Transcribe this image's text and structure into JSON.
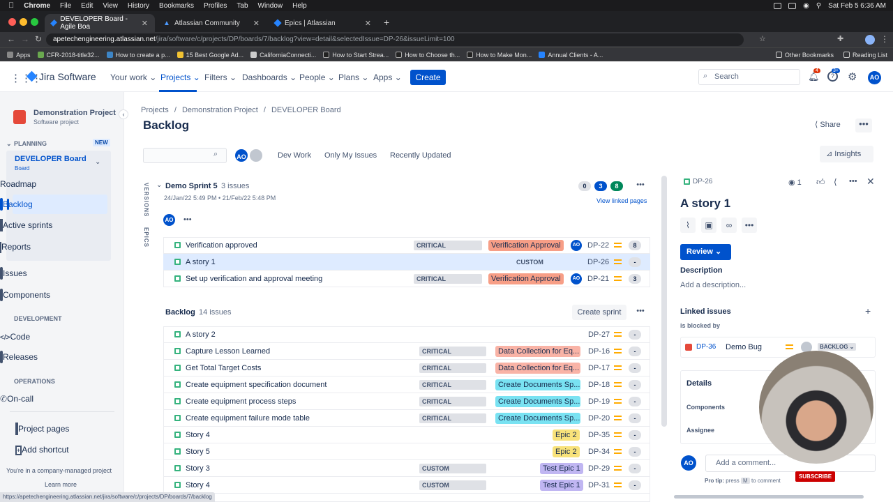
{
  "mac": {
    "app": "Chrome",
    "menus": [
      "File",
      "Edit",
      "View",
      "History",
      "Bookmarks",
      "Profiles",
      "Tab",
      "Window",
      "Help"
    ],
    "clock": "Sat Feb 5  6:36 AM"
  },
  "tabs": [
    {
      "label": "DEVELOPER Board - Agile Boa"
    },
    {
      "label": "Atlassian Community"
    },
    {
      "label": "Epics | Atlassian"
    }
  ],
  "address": {
    "host": "apetechengineering.atlassian.net",
    "path": "/jira/software/c/projects/DP/boards/7/backlog?view=detail&selectedIssue=DP-26&issueLimit=100"
  },
  "bookmarks": [
    "Apps",
    "CFR-2018-title32...",
    "How to create a p...",
    "15 Best Google Ad...",
    "CaliforniaConnecti...",
    "How to Start Strea...",
    "How to Choose th...",
    "How to Make Mon...",
    "Annual Clients - A..."
  ],
  "bookmarks_right": [
    "Other Bookmarks",
    "Reading List"
  ],
  "jira": {
    "logo": "Jira Software",
    "nav": [
      "Your work",
      "Projects",
      "Filters",
      "Dashboards",
      "People",
      "Plans",
      "Apps"
    ],
    "create": "Create",
    "search_placeholder": "Search",
    "notif_count": "4",
    "help_count": "3+",
    "user_initials": "AO"
  },
  "sidebar": {
    "project_name": "Demonstration Project",
    "project_type": "Software project",
    "planning": "PLANNING",
    "new_badge": "NEW",
    "board_name": "DEVELOPER Board",
    "board_sub": "Board",
    "planning_items": [
      "Roadmap",
      "Backlog",
      "Active sprints",
      "Reports"
    ],
    "other_items": [
      "Issues",
      "Components"
    ],
    "development": "DEVELOPMENT",
    "dev_items": [
      "Code",
      "Releases"
    ],
    "operations": "OPERATIONS",
    "ops_items": [
      "On-call"
    ],
    "footer_items": [
      "Project pages",
      "Add shortcut"
    ],
    "company_managed": "You're in a company-managed project",
    "learn_more": "Learn more"
  },
  "main": {
    "breadcrumbs": [
      "Projects",
      "Demonstration Project",
      "DEVELOPER Board"
    ],
    "title": "Backlog",
    "share": "Share",
    "insights": "Insights",
    "filters": [
      "Dev Work",
      "Only My Issues",
      "Recently Updated"
    ],
    "versions": "VERSIONS",
    "epics": "EPICS",
    "sprint": {
      "name": "Demo Sprint 5",
      "count": "3 issues",
      "dates": "24/Jan/22 5:49 PM  •  21/Feb/22 5:48 PM",
      "counts": [
        "0",
        "3",
        "8"
      ],
      "view_linked": "View linked pages",
      "issues": [
        {
          "title": "Verification approved",
          "label": "CRITICAL FUNCTIO...",
          "epic": "Verification Approval",
          "epic_color": "#f79e86",
          "assignee": "AO",
          "key": "DP-22",
          "est": "8"
        },
        {
          "title": "A story 1",
          "label": "CUSTOM SCHOLAR...",
          "epic": "",
          "epic_color": "",
          "assignee": "",
          "key": "DP-26",
          "est": "-"
        },
        {
          "title": "Set up verification and approval meeting",
          "label": "CRITICAL FUNCTIO...",
          "epic": "Verification Approval",
          "epic_color": "#f79e86",
          "assignee": "AO",
          "key": "DP-21",
          "est": "3"
        }
      ]
    },
    "backlog": {
      "name": "Backlog",
      "count": "14 issues",
      "create_sprint": "Create sprint",
      "issues": [
        {
          "title": "A story 2",
          "label": "",
          "epic": "",
          "epic_color": "",
          "key": "DP-27",
          "est": "-"
        },
        {
          "title": "Capture Lesson Learned",
          "label": "CRITICAL FUNCTIO...",
          "epic": "Data Collection for Eq...",
          "epic_color": "#f9b3a6",
          "key": "DP-16",
          "est": "-"
        },
        {
          "title": "Get Total Target Costs",
          "label": "CRITICAL FUNCTIO...",
          "epic": "Data Collection for Eq...",
          "epic_color": "#f9b3a6",
          "key": "DP-17",
          "est": "-"
        },
        {
          "title": "Create equipment specification document",
          "label": "CRITICAL FUNCTIO...",
          "epic": "Create Documents Sp...",
          "epic_color": "#79e2f2",
          "key": "DP-18",
          "est": "-"
        },
        {
          "title": "Create equipment process steps",
          "label": "CRITICAL FUNCTIO...",
          "epic": "Create Documents Sp...",
          "epic_color": "#79e2f2",
          "key": "DP-19",
          "est": "-"
        },
        {
          "title": "Create equipment failure mode table",
          "label": "CRITICAL FUNCTIO...",
          "epic": "Create Documents Sp...",
          "epic_color": "#79e2f2",
          "key": "DP-20",
          "est": "-"
        },
        {
          "title": "Story 4",
          "label": "",
          "epic": "Epic 2",
          "epic_color": "#f8e27a",
          "key": "DP-35",
          "est": "-"
        },
        {
          "title": "Story 5",
          "label": "",
          "epic": "Epic 2",
          "epic_color": "#f8e27a",
          "key": "DP-34",
          "est": "-"
        },
        {
          "title": "Story 3",
          "label": "CUSTOM SCHOLAR...",
          "epic": "Test Epic 1",
          "epic_color": "#c0b6f2",
          "key": "DP-29",
          "est": "-"
        },
        {
          "title": "Story 4",
          "label": "CUSTOM SCHOLAR...",
          "epic": "Test Epic 1",
          "epic_color": "#c0b6f2",
          "key": "DP-31",
          "est": "-"
        }
      ]
    }
  },
  "detail": {
    "key": "DP-26",
    "watchers": "1",
    "title": "A story 1",
    "status": "Review",
    "description_label": "Description",
    "description_placeholder": "Add a description...",
    "linked_label": "Linked issues",
    "blocked_by": "is blocked by",
    "linked_key": "DP-36",
    "linked_title": "Demo Bug",
    "linked_status": "BACKLOG",
    "details": "Details",
    "components": "Components",
    "assignee": "Assignee",
    "comment_placeholder": "Add a comment...",
    "pro_tip": "Pro tip:",
    "press": "press",
    "key_m": "M",
    "to_comment": "to comment",
    "subscribe": "SUBSCRIBE"
  },
  "status_url": "https://apetechengineering.atlassian.net/jira/software/c/projects/DP/boards/7/backlog"
}
